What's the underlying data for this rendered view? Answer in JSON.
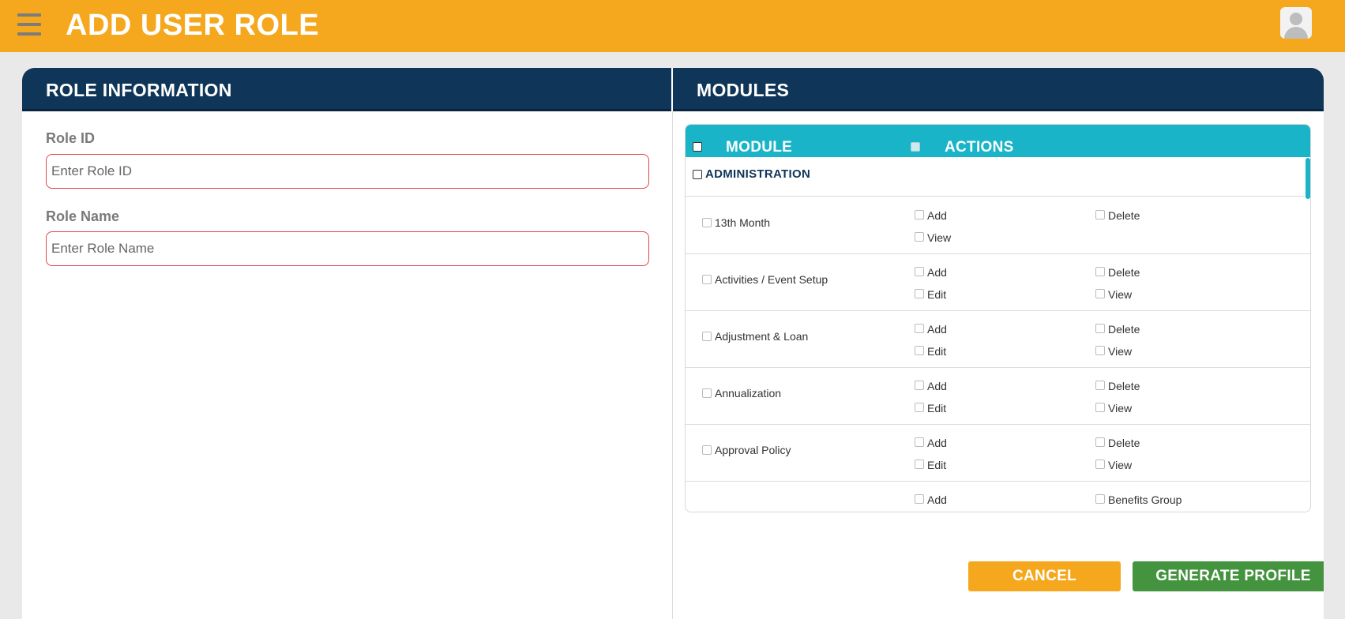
{
  "header": {
    "title": "ADD USER ROLE"
  },
  "role_info": {
    "title": "ROLE INFORMATION",
    "role_id_label": "Role ID",
    "role_id_placeholder": "Enter Role ID",
    "role_id_value": "",
    "role_name_label": "Role Name",
    "role_name_placeholder": "Enter Role Name",
    "role_name_value": ""
  },
  "modules": {
    "title": "MODULES",
    "col_module": "MODULE",
    "col_actions": "ACTIONS",
    "group": "ADMINISTRATION",
    "rows": [
      {
        "name": "13th Month",
        "actions": [
          "Add",
          "Delete",
          "View",
          ""
        ]
      },
      {
        "name": "Activities / Event Setup",
        "actions": [
          "Add",
          "Delete",
          "Edit",
          "View"
        ]
      },
      {
        "name": "Adjustment & Loan",
        "actions": [
          "Add",
          "Delete",
          "Edit",
          "View"
        ]
      },
      {
        "name": "Annualization",
        "actions": [
          "Add",
          "Delete",
          "Edit",
          "View"
        ]
      },
      {
        "name": "Approval Policy",
        "actions": [
          "Add",
          "Delete",
          "Edit",
          "View"
        ]
      },
      {
        "name": "",
        "actions": [
          "Add",
          "Benefits Group",
          "",
          ""
        ]
      }
    ]
  },
  "buttons": {
    "cancel": "CANCEL",
    "generate": "GENERATE PROFILE"
  },
  "colors": {
    "topbar": "#f5a81d",
    "navy": "#0f3558",
    "teal": "#1ab4c9",
    "green": "#43933f",
    "error_border": "#e0474c"
  }
}
